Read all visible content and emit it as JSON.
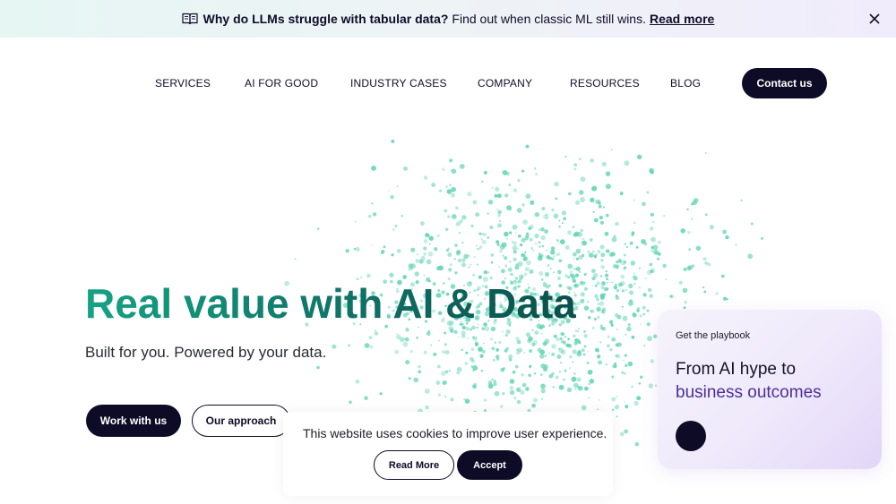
{
  "banner": {
    "icon": "book-icon",
    "headline": "Why do LLMs struggle with tabular data?",
    "text": "Find out when classic ML still wins.",
    "link": "Read more",
    "close_icon": "close-icon"
  },
  "nav": {
    "items": [
      "SERVICES",
      "AI FOR GOOD",
      "INDUSTRY CASES",
      "COMPANY",
      "RESOURCES",
      "BLOG"
    ],
    "cta": "Contact us"
  },
  "hero": {
    "title": "Real value with AI & Data",
    "subtitle": "Built for you. Powered by your data.",
    "primary_button": "Work with us",
    "secondary_button": "Our approach"
  },
  "cookie": {
    "text": "This website uses cookies to improve user experience.",
    "read_more": "Read More",
    "accept": "Accept"
  },
  "playbook": {
    "label": "Get the playbook",
    "line1": "From AI hype to",
    "line2": "business outcomes"
  },
  "colors": {
    "accent_dark": "#0e0b26",
    "brand_teal": "#14a383",
    "particle": "#5fd3b4",
    "purple": "#4b2d9a"
  }
}
